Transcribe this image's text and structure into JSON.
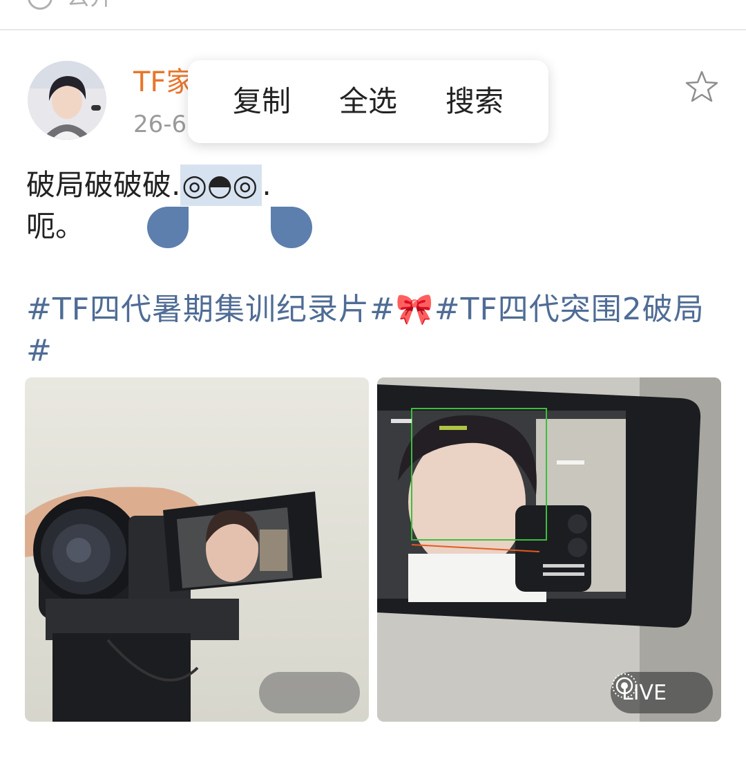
{
  "header": {
    "visibility_label": "公开",
    "visibility_icon": "globe-icon"
  },
  "post": {
    "author": "TF家",
    "time": "26-6",
    "text_line1_prefix": "破局破破破.",
    "text_line1_selected": "◎◓◎",
    "text_line1_suffix": ".",
    "text_line2": "呃。",
    "hashtags": [
      "#TF四代暑期集训纪录片#",
      "🎀",
      "#TF四代突围2破局#"
    ],
    "favorite_icon": "star-outline-icon"
  },
  "context_menu": {
    "items": [
      "复制",
      "全选",
      "搜索"
    ]
  },
  "photos": [
    {
      "name": "camera-photo",
      "badge": ""
    },
    {
      "name": "viewfinder-photo",
      "badge": "LIVE",
      "badge_icon": "live-photo-icon"
    }
  ],
  "colors": {
    "username": "#e8762c",
    "hashtag": "#4f6c95",
    "selection": "#d7e2f0",
    "handle": "#5c7fad"
  }
}
